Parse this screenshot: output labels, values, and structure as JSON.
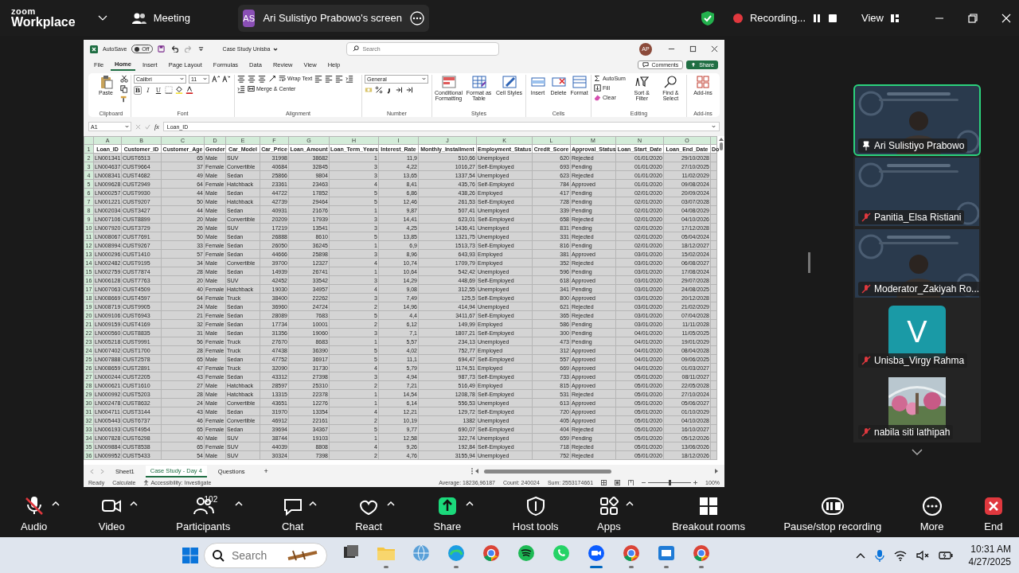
{
  "meeting_bar": {
    "brand": "zoom",
    "product": "Workplace",
    "meeting_label": "Meeting",
    "presenter_initials": "AS",
    "share_label": "Ari Sulistiyo Prabowo's screen",
    "recording_label": "Recording...",
    "view_label": "View"
  },
  "spreadsheet": {
    "autosave_label": "AutoSave",
    "autosave": {
      "label": "Off",
      "on": false
    },
    "document_title": "Case Study Unisba",
    "search": {
      "placeholder": "Search"
    },
    "user_initials": "AP",
    "menu_tabs": [
      {
        "label": "File",
        "selected": false
      },
      {
        "label": "Home",
        "selected": true
      },
      {
        "label": "Insert",
        "selected": false
      },
      {
        "label": "Page Layout",
        "selected": false
      },
      {
        "label": "Formulas",
        "selected": false
      },
      {
        "label": "Data",
        "selected": false
      },
      {
        "label": "Review",
        "selected": false
      },
      {
        "label": "View",
        "selected": false
      },
      {
        "label": "Help",
        "selected": false
      }
    ],
    "comments_label": "Comments",
    "share_label": "Share",
    "ribbon": [
      {
        "label": "Clipboard",
        "items": [
          {
            "kind": "large",
            "label": "Paste"
          }
        ]
      },
      {
        "label": "Font",
        "items": [
          {
            "kind": "field",
            "value": "Calibri"
          },
          {
            "kind": "field",
            "value": "11"
          },
          {
            "kind": "char",
            "label": "B"
          },
          {
            "kind": "char",
            "label": "I"
          },
          {
            "kind": "char",
            "label": "U"
          }
        ]
      },
      {
        "label": "Alignment",
        "items": [
          {
            "kind": "small",
            "label": "Wrap Text"
          },
          {
            "kind": "small",
            "label": "Merge & Center"
          }
        ]
      },
      {
        "label": "Number",
        "items": [
          {
            "kind": "field",
            "value": "General"
          }
        ]
      },
      {
        "label": "Styles",
        "items": [
          {
            "kind": "large",
            "label": "Conditional Formatting"
          },
          {
            "kind": "large",
            "label": "Format as Table"
          },
          {
            "kind": "large",
            "label": "Cell Styles"
          }
        ]
      },
      {
        "label": "Cells",
        "items": [
          {
            "kind": "large",
            "label": "Insert"
          },
          {
            "kind": "large",
            "label": "Delete"
          },
          {
            "kind": "large",
            "label": "Format"
          }
        ]
      },
      {
        "label": "Editing",
        "items": [
          {
            "kind": "small",
            "label": "AutoSum"
          },
          {
            "kind": "small",
            "label": "Fill"
          },
          {
            "kind": "small",
            "label": "Clear"
          },
          {
            "kind": "large",
            "label": "Sort & Filter"
          },
          {
            "kind": "large",
            "label": "Find & Select"
          }
        ]
      },
      {
        "label": "Add-ins",
        "items": [
          {
            "kind": "large",
            "label": "Add-ins"
          }
        ]
      }
    ],
    "name_box": "A1",
    "function_label": "fx",
    "formula": "Loan_ID",
    "all_selected": true,
    "columns": [
      {
        "letter": "A",
        "kind": "text"
      },
      {
        "letter": "B",
        "kind": "text"
      },
      {
        "letter": "C",
        "kind": "number"
      },
      {
        "letter": "D",
        "kind": "text"
      },
      {
        "letter": "E",
        "kind": "text"
      },
      {
        "letter": "F",
        "kind": "number"
      },
      {
        "letter": "G",
        "kind": "number"
      },
      {
        "letter": "H",
        "kind": "number"
      },
      {
        "letter": "I",
        "kind": "number"
      },
      {
        "letter": "J",
        "kind": "number"
      },
      {
        "letter": "K",
        "kind": "text"
      },
      {
        "letter": "L",
        "kind": "number"
      },
      {
        "letter": "M",
        "kind": "text"
      },
      {
        "letter": "N",
        "kind": "number"
      },
      {
        "letter": "O",
        "kind": "number"
      },
      {
        "kind": "text"
      }
    ],
    "rows": [
      {
        "number": "1",
        "kind": "header",
        "cells": [
          "Loan_ID",
          "Customer_ID",
          "Customer_Age",
          "Gender",
          "Car_Model",
          "Car_Price",
          "Loan_Amount",
          "Loan_Term_Years",
          "Interest_Rate",
          "Monthly_Installment",
          "Employment_Status",
          "Credit_Score",
          "Approval_Status",
          "Loan_Start_Date",
          "Loan_End_Date",
          "Do"
        ]
      },
      {
        "number": "2",
        "kind": "data",
        "cells": [
          "LN001341",
          "CUST6513",
          "65",
          "Male",
          "SUV",
          "31998",
          "38682",
          "1",
          "11,9",
          "510,66",
          "Unemployed",
          "620",
          "Rejected",
          "01/01/2020",
          "29/10/2028"
        ]
      },
      {
        "number": "3",
        "kind": "data",
        "cells": [
          "LN004637",
          "CUST9664",
          "37",
          "Female",
          "Convertible",
          "40684",
          "32845",
          "3",
          "4,22",
          "1016,27",
          "Self-Employed",
          "693",
          "Pending",
          "01/01/2020",
          "27/10/2025"
        ]
      },
      {
        "number": "4",
        "kind": "data",
        "cells": [
          "LN008341",
          "CUST4682",
          "49",
          "Male",
          "Sedan",
          "25866",
          "9804",
          "3",
          "13,65",
          "1337,54",
          "Unemployed",
          "623",
          "Rejected",
          "01/01/2020",
          "11/02/2029"
        ]
      },
      {
        "number": "5",
        "kind": "data",
        "cells": [
          "LN009628",
          "CUST2949",
          "64",
          "Female",
          "Hatchback",
          "23361",
          "23463",
          "4",
          "8,41",
          "435,76",
          "Self-Employed",
          "784",
          "Approved",
          "01/01/2020",
          "09/08/2024"
        ]
      },
      {
        "number": "6",
        "kind": "data",
        "cells": [
          "LN000257",
          "CUST9930",
          "44",
          "Male",
          "Sedan",
          "44722",
          "17852",
          "5",
          "6,86",
          "438,26",
          "Employed",
          "417",
          "Pending",
          "02/01/2020",
          "20/09/2024"
        ]
      },
      {
        "number": "7",
        "kind": "data",
        "cells": [
          "LN001221",
          "CUST9207",
          "50",
          "Male",
          "Hatchback",
          "42739",
          "29464",
          "5",
          "12,46",
          "261,53",
          "Self-Employed",
          "728",
          "Pending",
          "02/01/2020",
          "03/07/2028"
        ]
      },
      {
        "number": "8",
        "kind": "data",
        "cells": [
          "LN002034",
          "CUST3427",
          "44",
          "Male",
          "Sedan",
          "40931",
          "21676",
          "1",
          "9,87",
          "507,41",
          "Unemployed",
          "339",
          "Pending",
          "02/01/2020",
          "04/08/2029"
        ]
      },
      {
        "number": "9",
        "kind": "data",
        "cells": [
          "LN007106",
          "CUST8899",
          "20",
          "Male",
          "Convertible",
          "20209",
          "17939",
          "3",
          "14,41",
          "623,01",
          "Self-Employed",
          "658",
          "Rejected",
          "02/01/2020",
          "04/10/2026"
        ]
      },
      {
        "number": "10",
        "kind": "data",
        "cells": [
          "LN007920",
          "CUST3729",
          "26",
          "Male",
          "SUV",
          "17219",
          "13541",
          "3",
          "4,25",
          "1436,41",
          "Unemployed",
          "831",
          "Pending",
          "02/01/2020",
          "17/12/2028"
        ]
      },
      {
        "number": "11",
        "kind": "data",
        "cells": [
          "LN008067",
          "CUST7691",
          "50",
          "Male",
          "Sedan",
          "26888",
          "8610",
          "5",
          "13,85",
          "1321,75",
          "Unemployed",
          "331",
          "Rejected",
          "02/01/2020",
          "05/04/2024"
        ]
      },
      {
        "number": "12",
        "kind": "data",
        "cells": [
          "LN008994",
          "CUST9267",
          "33",
          "Female",
          "Sedan",
          "26050",
          "36245",
          "1",
          "6,9",
          "1513,73",
          "Self-Employed",
          "816",
          "Pending",
          "02/01/2020",
          "18/12/2027"
        ]
      },
      {
        "number": "13",
        "kind": "data",
        "cells": [
          "LN000296",
          "CUST1410",
          "57",
          "Female",
          "Sedan",
          "44666",
          "25898",
          "3",
          "8,96",
          "643,93",
          "Employed",
          "381",
          "Approved",
          "03/01/2020",
          "15/02/2024"
        ]
      },
      {
        "number": "14",
        "kind": "data",
        "cells": [
          "LN002482",
          "CUST9195",
          "34",
          "Male",
          "Convertible",
          "39700",
          "12327",
          "4",
          "10,74",
          "1709,79",
          "Employed",
          "352",
          "Rejected",
          "03/01/2020",
          "06/08/2027"
        ]
      },
      {
        "number": "15",
        "kind": "data",
        "cells": [
          "LN002759",
          "CUST7874",
          "28",
          "Male",
          "Sedan",
          "14939",
          "26741",
          "1",
          "10,64",
          "542,42",
          "Unemployed",
          "596",
          "Pending",
          "03/01/2020",
          "17/08/2024"
        ]
      },
      {
        "number": "16",
        "kind": "data",
        "cells": [
          "LN006128",
          "CUST7763",
          "20",
          "Male",
          "SUV",
          "42452",
          "33542",
          "3",
          "14,29",
          "448,69",
          "Self-Employed",
          "618",
          "Approved",
          "03/01/2020",
          "29/07/2028"
        ]
      },
      {
        "number": "17",
        "kind": "data",
        "cells": [
          "LN007063",
          "CUST4509",
          "40",
          "Female",
          "Hatchback",
          "19030",
          "34957",
          "4",
          "9,08",
          "312,55",
          "Unemployed",
          "341",
          "Pending",
          "03/01/2020",
          "24/08/2025"
        ]
      },
      {
        "number": "18",
        "kind": "data",
        "cells": [
          "LN008669",
          "CUST4597",
          "64",
          "Female",
          "Truck",
          "38400",
          "22262",
          "3",
          "7,49",
          "125,5",
          "Self-Employed",
          "800",
          "Approved",
          "03/01/2020",
          "20/12/2028"
        ]
      },
      {
        "number": "19",
        "kind": "data",
        "cells": [
          "LN008719",
          "CUST9905",
          "24",
          "Male",
          "Sedan",
          "36960",
          "24724",
          "2",
          "14,96",
          "414,94",
          "Unemployed",
          "621",
          "Rejected",
          "03/01/2020",
          "21/02/2029"
        ]
      },
      {
        "number": "20",
        "kind": "data",
        "cells": [
          "LN009106",
          "CUST6943",
          "21",
          "Female",
          "Sedan",
          "28089",
          "7683",
          "5",
          "4,4",
          "3411,67",
          "Self-Employed",
          "365",
          "Rejected",
          "03/01/2020",
          "07/04/2028"
        ]
      },
      {
        "number": "21",
        "kind": "data",
        "cells": [
          "LN009159",
          "CUST4169",
          "32",
          "Female",
          "Sedan",
          "17734",
          "10001",
          "2",
          "6,12",
          "149,99",
          "Employed",
          "586",
          "Pending",
          "03/01/2020",
          "11/11/2028"
        ]
      },
      {
        "number": "22",
        "kind": "data",
        "cells": [
          "LN000560",
          "CUST8835",
          "31",
          "Male",
          "Sedan",
          "31356",
          "19060",
          "3",
          "7,1",
          "1807,21",
          "Self-Employed",
          "300",
          "Pending",
          "04/01/2020",
          "11/05/2025"
        ]
      },
      {
        "number": "23",
        "kind": "data",
        "cells": [
          "LN005218",
          "CUST9991",
          "56",
          "Female",
          "Truck",
          "27670",
          "8683",
          "1",
          "5,57",
          "234,13",
          "Unemployed",
          "473",
          "Pending",
          "04/01/2020",
          "19/01/2029"
        ]
      },
      {
        "number": "24",
        "kind": "data",
        "cells": [
          "LN007402",
          "CUST1700",
          "28",
          "Female",
          "Truck",
          "47438",
          "36390",
          "5",
          "4,02",
          "752,77",
          "Employed",
          "312",
          "Approved",
          "04/01/2020",
          "08/04/2028"
        ]
      },
      {
        "number": "25",
        "kind": "data",
        "cells": [
          "LN007888",
          "CUST2578",
          "65",
          "Male",
          "Sedan",
          "47752",
          "36917",
          "5",
          "11,1",
          "694,47",
          "Self-Employed",
          "557",
          "Approved",
          "04/01/2020",
          "09/06/2025"
        ]
      },
      {
        "number": "26",
        "kind": "data",
        "cells": [
          "LN008659",
          "CUST2891",
          "47",
          "Female",
          "Truck",
          "32090",
          "31730",
          "4",
          "5,79",
          "1174,51",
          "Employed",
          "669",
          "Approved",
          "04/01/2020",
          "01/03/2027"
        ]
      },
      {
        "number": "27",
        "kind": "data",
        "cells": [
          "LN000244",
          "CUST2205",
          "43",
          "Female",
          "Sedan",
          "43312",
          "27398",
          "3",
          "4,94",
          "987,73",
          "Self-Employed",
          "733",
          "Approved",
          "05/01/2020",
          "08/11/2027"
        ]
      },
      {
        "number": "28",
        "kind": "data",
        "cells": [
          "LN000621",
          "CUST1610",
          "27",
          "Male",
          "Hatchback",
          "28597",
          "25310",
          "2",
          "7,21",
          "516,49",
          "Employed",
          "815",
          "Approved",
          "05/01/2020",
          "22/05/2028"
        ]
      },
      {
        "number": "29",
        "kind": "data",
        "cells": [
          "LN000992",
          "CUST5203",
          "28",
          "Male",
          "Hatchback",
          "13315",
          "22378",
          "1",
          "14,54",
          "1208,78",
          "Self-Employed",
          "531",
          "Rejected",
          "05/01/2020",
          "27/10/2024"
        ]
      },
      {
        "number": "30",
        "kind": "data",
        "cells": [
          "LN002478",
          "CUST8632",
          "24",
          "Male",
          "Convertible",
          "43651",
          "12276",
          "1",
          "6,14",
          "556,53",
          "Unemployed",
          "613",
          "Approved",
          "05/01/2020",
          "05/06/2027"
        ]
      },
      {
        "number": "31",
        "kind": "data",
        "cells": [
          "LN004711",
          "CUST3144",
          "43",
          "Male",
          "Sedan",
          "31970",
          "13354",
          "4",
          "12,21",
          "129,72",
          "Self-Employed",
          "720",
          "Approved",
          "05/01/2020",
          "01/10/2029"
        ]
      },
      {
        "number": "32",
        "kind": "data",
        "cells": [
          "LN005443",
          "CUST6737",
          "46",
          "Female",
          "Convertible",
          "46912",
          "22161",
          "2",
          "10,19",
          "1382",
          "Unemployed",
          "405",
          "Approved",
          "05/01/2020",
          "04/10/2028"
        ]
      },
      {
        "number": "33",
        "kind": "data",
        "cells": [
          "LN006193",
          "CUST4954",
          "65",
          "Female",
          "Sedan",
          "39694",
          "34367",
          "5",
          "9,77",
          "690,07",
          "Self-Employed",
          "404",
          "Rejected",
          "05/01/2020",
          "16/10/2027"
        ]
      },
      {
        "number": "34",
        "kind": "data",
        "cells": [
          "LN007828",
          "CUST6298",
          "40",
          "Male",
          "SUV",
          "38744",
          "19103",
          "1",
          "12,58",
          "322,74",
          "Unemployed",
          "659",
          "Pending",
          "05/01/2020",
          "05/12/2026"
        ]
      },
      {
        "number": "35",
        "kind": "data",
        "cells": [
          "LN009884",
          "CUST8538",
          "65",
          "Female",
          "SUV",
          "44039",
          "8808",
          "4",
          "9,26",
          "192,84",
          "Self-Employed",
          "718",
          "Rejected",
          "05/01/2020",
          "13/06/2026"
        ]
      },
      {
        "number": "36",
        "kind": "data",
        "cells": [
          "LN009952",
          "CUST5433",
          "54",
          "Male",
          "SUV",
          "30324",
          "7398",
          "2",
          "4,76",
          "3155,94",
          "Unemployed",
          "752",
          "Rejected",
          "05/01/2020",
          "18/12/2026"
        ]
      }
    ],
    "sheet_tabs": [
      {
        "label": "Sheet1",
        "selected": false
      },
      {
        "label": "Case Study - Day 4",
        "selected": true
      },
      {
        "label": "Questions",
        "selected": false
      }
    ],
    "add_sheet": "+",
    "status_left": [
      "Ready",
      "Calculate"
    ],
    "accessibility": "Accessibility: Investigate",
    "summary": [
      "Average: 18236,96187",
      "Count: 240024",
      "Sum: 2553174661"
    ],
    "zoom_slider": {
      "level": 0.5
    },
    "zoom_level": "100%"
  },
  "participants": [
    {
      "name": "Ari Sulistiyo Prabowo",
      "kind": "video",
      "speaking": true,
      "muted": false,
      "pinned": true
    },
    {
      "name": "Panitia_Elsa Ristiani",
      "kind": "slide",
      "speaking": false,
      "muted": true,
      "pinned": false
    },
    {
      "name": "Moderator_Zakiyah Ro...",
      "kind": "video",
      "speaking": false,
      "muted": true,
      "pinned": false
    },
    {
      "name": "Unisba_Virgy Rahma",
      "kind": "avatar",
      "initial": "V",
      "speaking": false,
      "muted": true,
      "pinned": false
    },
    {
      "name": "nabila siti lathipah",
      "speaking": false,
      "muted": true,
      "pinned": false
    }
  ],
  "toolbar": [
    {
      "label": "Audio",
      "has_menu": true,
      "muted": true
    },
    {
      "label": "Video",
      "has_menu": true,
      "muted": false
    },
    {
      "label": "Participants",
      "has_menu": true,
      "count": "102"
    },
    {
      "label": "Chat",
      "has_menu": true
    },
    {
      "label": "React",
      "has_menu": true
    },
    {
      "label": "Share",
      "has_menu": true
    },
    {
      "label": "Host tools",
      "has_menu": false
    },
    {
      "label": "Apps",
      "has_menu": true
    },
    {
      "label": "Breakout rooms",
      "has_menu": false
    },
    {
      "label": "Pause/stop recording",
      "has_menu": false
    },
    {
      "label": "More",
      "has_menu": false
    },
    {
      "label": "End",
      "has_menu": false
    }
  ],
  "taskbar": {
    "search_placeholder": "Search",
    "apps": [
      {
        "running": false,
        "active": false
      },
      {
        "running": true,
        "active": false
      },
      {
        "running": false,
        "active": false
      },
      {
        "running": true,
        "active": false
      },
      {
        "running": false,
        "active": false
      },
      {
        "running": false,
        "active": false
      },
      {
        "running": false,
        "active": false
      },
      {
        "running": true,
        "active": true
      },
      {
        "running": true,
        "active": false
      },
      {
        "running": true,
        "active": false
      },
      {
        "running": true,
        "active": false
      }
    ],
    "time": "10:31 AM",
    "date": "4/27/2025"
  }
}
